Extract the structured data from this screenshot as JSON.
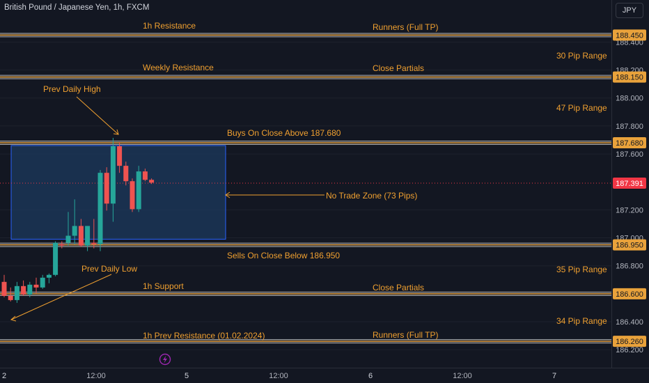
{
  "header": {
    "title": "British Pound / Japanese Yen, 1h, FXCM",
    "currency_button": "JPY"
  },
  "colors": {
    "background": "#131722",
    "up": "#26a69a",
    "down": "#ef5350",
    "annotation": "#f0a030",
    "level_line": "#a8a8a8",
    "zone_fill": "#1c3a5e",
    "zone_border": "#2962ff",
    "axis_text": "#b2b5be",
    "current_price_label": "#f23645"
  },
  "chart_data": {
    "type": "candlestick",
    "instrument": "British Pound / Japanese Yen",
    "timeframe": "1h",
    "source": "FXCM",
    "y_axis": {
      "range": [
        186.16,
        188.58
      ],
      "ticks": [
        "188.400",
        "188.200",
        "188.000",
        "187.800",
        "187.600",
        "187.200",
        "187.000",
        "186.800",
        "186.400",
        "186.200"
      ]
    },
    "x_axis": {
      "ticks": [
        "2",
        "12:00",
        "5",
        "12:00",
        "6",
        "12:00",
        "7"
      ]
    },
    "price_labels": [
      {
        "value": 188.45,
        "text": "188.450"
      },
      {
        "value": 188.15,
        "text": "188.150"
      },
      {
        "value": 187.68,
        "text": "187.680"
      },
      {
        "value": 186.95,
        "text": "186.950"
      },
      {
        "value": 186.6,
        "text": "186.600"
      },
      {
        "value": 186.26,
        "text": "186.260"
      }
    ],
    "current_price": {
      "value": 187.391,
      "text": "187.391"
    },
    "horizontal_levels": [
      188.45,
      188.15,
      187.68,
      186.95,
      186.6,
      186.26
    ],
    "annotations": {
      "res_1h": "1h Resistance",
      "runners_top": "Runners (Full TP)",
      "range_30": "30 Pip Range",
      "weekly_res": "Weekly Resistance",
      "close_partials_top": "Close Partials",
      "prev_daily_high": "Prev Daily High",
      "range_47": "47 Pip Range",
      "buys_above": "Buys On Close Above 187.680",
      "no_trade_zone": "No Trade Zone (73 Pips)",
      "sells_below": "Sells On Close Below 186.950",
      "prev_daily_low": "Prev Daily Low",
      "range_35": "35 Pip Range",
      "support_1h": "1h Support",
      "close_partials_bottom": "Close Partials",
      "range_34": "34 Pip Range",
      "prev_res_1h": "1h Prev Resistance (01.02.2024)",
      "runners_bottom": "Runners (Full TP)"
    },
    "no_trade_zone": {
      "top": 187.66,
      "bottom": 186.99
    },
    "candles": [
      {
        "o": 186.685,
        "h": 186.735,
        "l": 186.575,
        "c": 186.585
      },
      {
        "o": 186.585,
        "h": 186.645,
        "l": 186.545,
        "c": 186.555
      },
      {
        "o": 186.555,
        "h": 186.685,
        "l": 186.535,
        "c": 186.655
      },
      {
        "o": 186.655,
        "h": 186.695,
        "l": 186.585,
        "c": 186.595
      },
      {
        "o": 186.595,
        "h": 186.685,
        "l": 186.575,
        "c": 186.665
      },
      {
        "o": 186.665,
        "h": 186.715,
        "l": 186.605,
        "c": 186.645
      },
      {
        "o": 186.645,
        "h": 186.735,
        "l": 186.635,
        "c": 186.715
      },
      {
        "o": 186.715,
        "h": 186.745,
        "l": 186.675,
        "c": 186.735
      },
      {
        "o": 186.735,
        "h": 186.975,
        "l": 186.725,
        "c": 186.965
      },
      {
        "o": 186.955,
        "h": 186.975,
        "l": 186.925,
        "c": 186.945
      },
      {
        "o": 186.965,
        "h": 187.185,
        "l": 186.945,
        "c": 187.015
      },
      {
        "o": 187.015,
        "h": 187.275,
        "l": 186.955,
        "c": 187.085
      },
      {
        "o": 187.085,
        "h": 187.135,
        "l": 186.935,
        "c": 186.945
      },
      {
        "o": 186.945,
        "h": 187.085,
        "l": 186.905,
        "c": 187.085
      },
      {
        "o": 186.965,
        "h": 187.135,
        "l": 186.925,
        "c": 186.955
      },
      {
        "o": 186.955,
        "h": 187.485,
        "l": 186.905,
        "c": 187.465
      },
      {
        "o": 187.465,
        "h": 187.505,
        "l": 187.195,
        "c": 187.245
      },
      {
        "o": 187.245,
        "h": 187.715,
        "l": 187.115,
        "c": 187.655
      },
      {
        "o": 187.655,
        "h": 187.685,
        "l": 187.465,
        "c": 187.515
      },
      {
        "o": 187.515,
        "h": 187.545,
        "l": 187.375,
        "c": 187.405
      },
      {
        "o": 187.405,
        "h": 187.425,
        "l": 187.185,
        "c": 187.205
      },
      {
        "o": 187.205,
        "h": 187.515,
        "l": 187.185,
        "c": 187.475
      },
      {
        "o": 187.475,
        "h": 187.495,
        "l": 187.405,
        "c": 187.415
      },
      {
        "o": 187.415,
        "h": 187.425,
        "l": 187.385,
        "c": 187.395
      }
    ]
  }
}
